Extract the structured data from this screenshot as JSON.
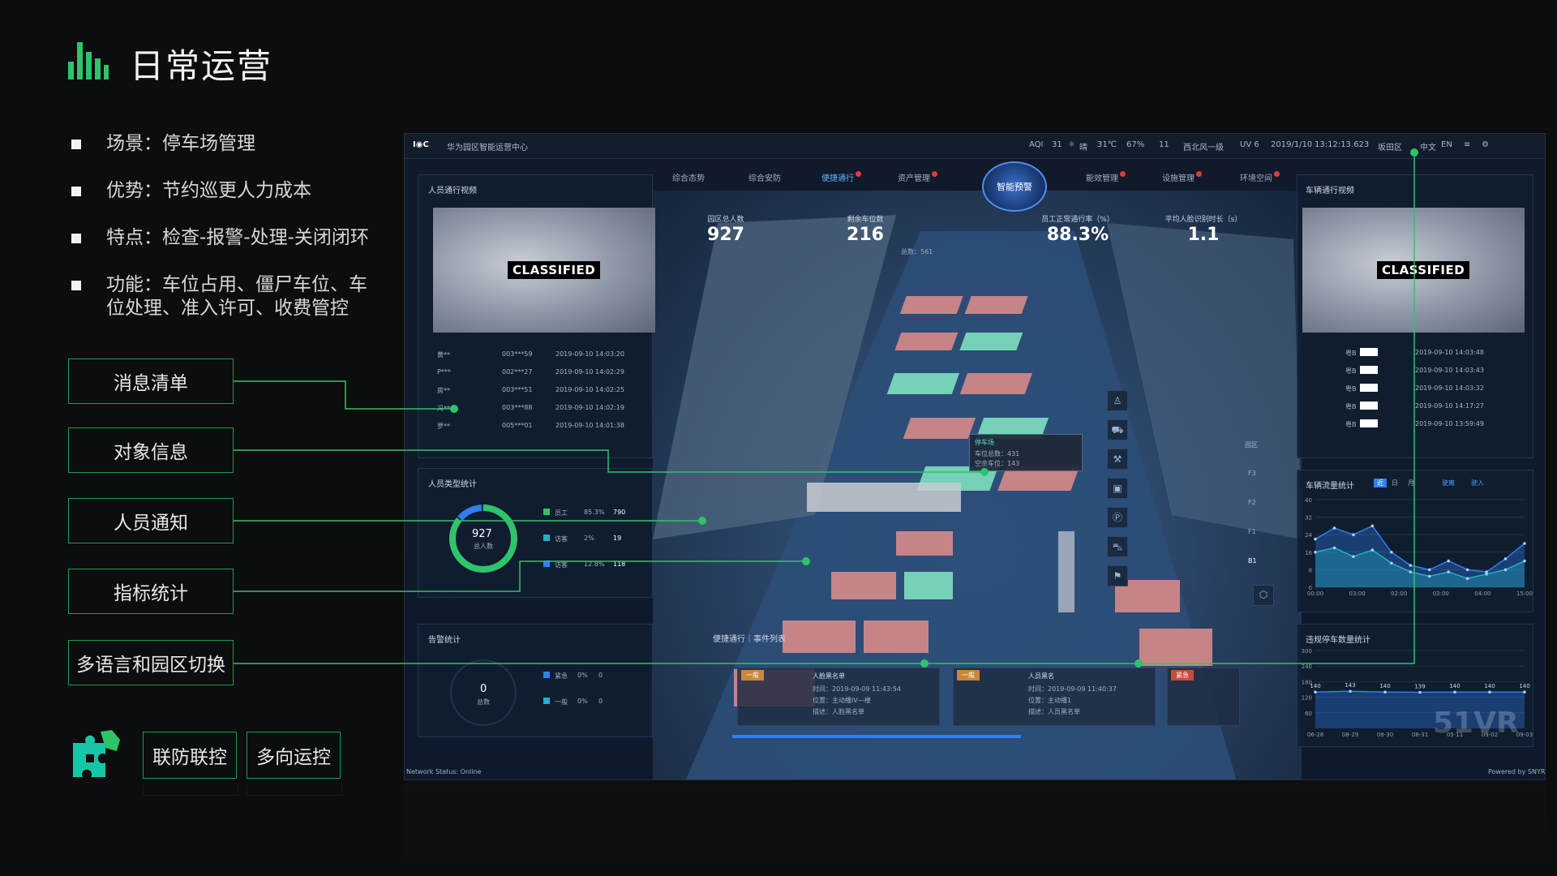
{
  "page": {
    "title": "日常运营",
    "bullets": [
      "场景：停车场管理",
      "优势：节约巡更人力成本",
      "特点：检查-报警-处理-关闭闭环",
      "功能：车位占用、僵尸车位、车\n位处理、准入许可、收费管控"
    ],
    "labels": [
      "消息清单",
      "对象信息",
      "人员通知",
      "指标统计",
      "多语言和园区切换"
    ],
    "bottom_buttons": [
      "联防联控",
      "多向运控"
    ]
  },
  "dashboard": {
    "logo": "I◉C",
    "system_name": "华为园区智能运营中心",
    "topbar": [
      "AQI",
      "31",
      "晴",
      "31℃",
      "67%",
      "11",
      "西北风一级",
      "UV 6",
      "2019/1/10",
      "13:12:13.623",
      "坂田区",
      "中文",
      "EN"
    ],
    "nav": [
      {
        "label": "综合态势",
        "badge": false,
        "active": false
      },
      {
        "label": "综合安防",
        "badge": false,
        "active": false
      },
      {
        "label": "便捷通行",
        "badge": true,
        "active": true
      },
      {
        "label": "资产管理",
        "badge": true,
        "active": false
      },
      {
        "label": "能效管理",
        "badge": true,
        "active": false
      },
      {
        "label": "设施管理",
        "badge": true,
        "active": false
      },
      {
        "label": "环境空间",
        "badge": true,
        "active": false
      }
    ],
    "center_button": "智能预警",
    "person_video": {
      "title": "人员通行视频",
      "classified": "CLASSIFIED"
    },
    "vehicle_video": {
      "title": "车辆通行视频",
      "classified": "CLASSIFIED"
    },
    "person_rows": [
      [
        "黄**",
        "003***59",
        "2019-09-10 14:03:20"
      ],
      [
        "P***",
        "002***27",
        "2019-09-10 14:02:29"
      ],
      [
        "房**",
        "003***51",
        "2019-09-10 14:02:25"
      ],
      [
        "冯**",
        "003***88",
        "2019-09-10 14:02:19"
      ],
      [
        "罗**",
        "005***01",
        "2019-09-10 14:01:38"
      ]
    ],
    "vehicle_rows": [
      [
        "粤B",
        "2019-09-10 14:03:48"
      ],
      [
        "粤B",
        "2019-09-10 14:03:43"
      ],
      [
        "粤B",
        "2019-09-10 14:03:32"
      ],
      [
        "粤B",
        "2019-09-10 14:17:27"
      ],
      [
        "粤B",
        "2019-09-10 13:59:49"
      ]
    ],
    "kpis": [
      {
        "label": "园区总人数",
        "value": "927"
      },
      {
        "label": "剩余车位数",
        "value": "216",
        "sub": "总数：561"
      },
      {
        "label": "员工正常通行率（%）",
        "value": "88.3%"
      },
      {
        "label": "平均人脸识别时长（s）",
        "value": "1.1"
      }
    ],
    "parking_popup": {
      "title": "停车场",
      "line1": "车位总数：431",
      "line2": "空余车位：143"
    },
    "person_type": {
      "title": "人员类型统计",
      "total": "927",
      "total_label": "总人数",
      "items": [
        {
          "name": "员工",
          "pct": "85.3%",
          "count": "790",
          "color": "#2fc36b"
        },
        {
          "name": "访客",
          "pct": "2%",
          "count": "19",
          "color": "#22b1c9"
        },
        {
          "name": "访客",
          "pct": "12.8%",
          "count": "118",
          "color": "#2f7ff0"
        }
      ]
    },
    "alarm_stats": {
      "title": "告警统计",
      "total": "0",
      "total_label": "总数",
      "items": [
        {
          "name": "紧急",
          "pct": "0%",
          "count": "0",
          "color": "#2f7ff0"
        },
        {
          "name": "一般",
          "pct": "0%",
          "count": "0",
          "color": "#22b1c9"
        }
      ]
    },
    "events": {
      "title": "便捷通行｜事件列表",
      "cards": [
        {
          "tag": "一般",
          "title": "人脸黑名单",
          "time": "时间：2019-09-09 11:43:54",
          "loc": "位置：主动播IV—楼",
          "desc": "描述：人脸黑名单"
        },
        {
          "tag": "一般",
          "title": "人员黑名",
          "time": "时间：2019-09-09 11:40:37",
          "loc": "位置：主动播1",
          "desc": "描述：人员黑名单"
        },
        {
          "tag": "紧急"
        }
      ]
    },
    "floors": [
      "园区",
      "F3",
      "F2",
      "F1",
      "B1"
    ],
    "flow_chart_title": "车辆流量统计",
    "flow_tabs": [
      "近",
      "日",
      "月"
    ],
    "flow_legend": [
      "驶离",
      "驶入"
    ],
    "parking_chart_title": "违规停车数量统计",
    "network_status": "Network Status:  Online",
    "powered_by": "Powered by SNYR",
    "watermark": "51VR"
  },
  "chart_data": [
    {
      "type": "area",
      "title": "车辆流量统计",
      "x": [
        "00:00",
        "03:00",
        "02:00",
        "03:00",
        "04:00",
        "15:00"
      ],
      "ylim": [
        0,
        40
      ],
      "yticks": [
        0,
        8,
        16,
        24,
        32,
        40
      ],
      "series": [
        {
          "name": "驶离",
          "values": [
            22,
            27,
            24,
            28,
            16,
            10,
            8,
            12,
            8,
            7,
            13,
            20
          ]
        },
        {
          "name": "驶入",
          "values": [
            16,
            18,
            14,
            17,
            11,
            7,
            5,
            7,
            4,
            6,
            8,
            12
          ]
        }
      ]
    },
    {
      "type": "area",
      "title": "违规停车数量统计",
      "x": [
        "06-28",
        "08-29",
        "08-30",
        "08-31",
        "05-11",
        "09-02",
        "09-03"
      ],
      "ylim": [
        0,
        300
      ],
      "yticks": [
        60,
        120,
        180,
        240,
        300
      ],
      "series": [
        {
          "values": [
            140,
            143,
            140,
            139,
            140,
            140,
            140
          ]
        }
      ]
    }
  ]
}
